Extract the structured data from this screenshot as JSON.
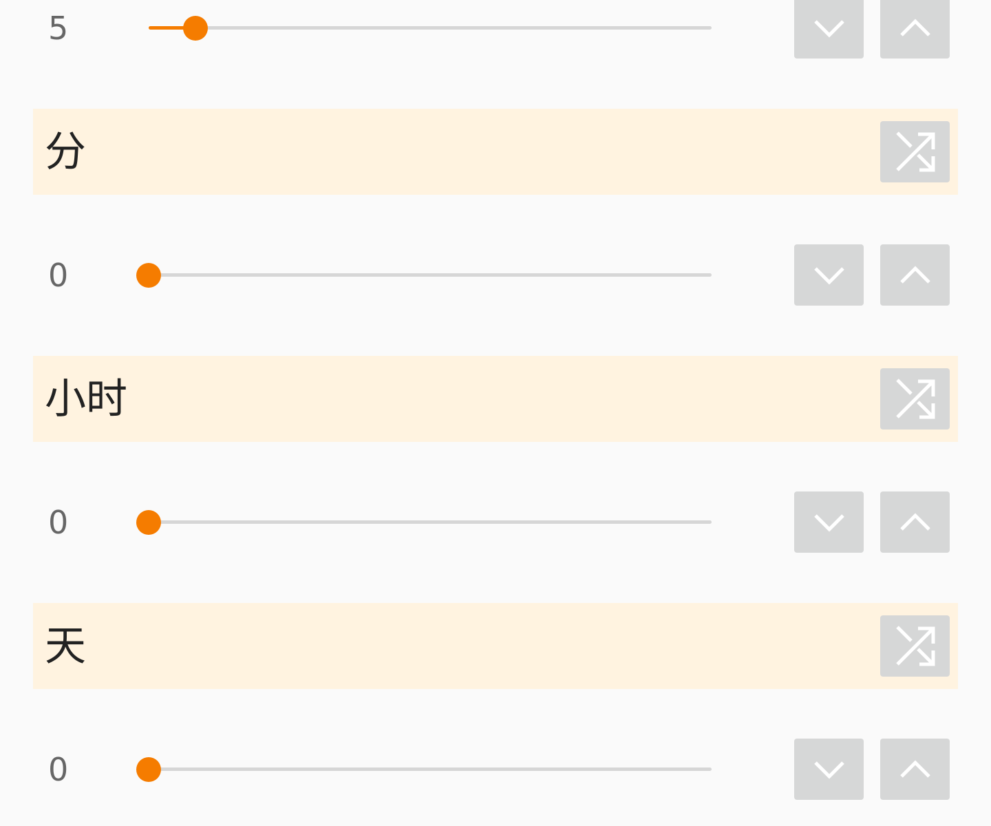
{
  "colors": {
    "background": "#fafafa",
    "accent": "#f57c00",
    "section_background": "#fff3e0",
    "button_background": "#d6d7d7",
    "track": "#d6d6d6"
  },
  "sliders": [
    {
      "id": "seconds",
      "value": "5",
      "fraction": 0.083
    },
    {
      "id": "minutes",
      "value": "0",
      "fraction": 0
    },
    {
      "id": "hours",
      "value": "0",
      "fraction": 0
    },
    {
      "id": "days",
      "value": "0",
      "fraction": 0
    }
  ],
  "sections": [
    {
      "id": "minutes",
      "title": "分",
      "icon": "shuffle-icon"
    },
    {
      "id": "hours",
      "title": "小时",
      "icon": "shuffle-icon"
    },
    {
      "id": "days",
      "title": "天",
      "icon": "shuffle-icon"
    }
  ],
  "buttons": {
    "decrement_icon": "chevron-down-icon",
    "increment_icon": "chevron-up-icon"
  }
}
